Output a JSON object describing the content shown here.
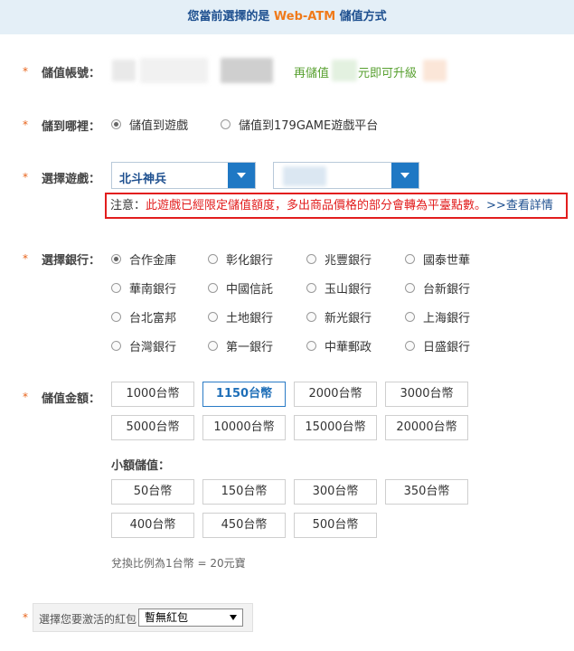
{
  "header": {
    "prefix": "您當前選擇的是 ",
    "method": "Web-ATM",
    "suffix": " 儲值方式"
  },
  "account": {
    "label": "儲值帳號：",
    "upgrade_prefix": "再儲值",
    "upgrade_suffix": "元即可升級"
  },
  "destination": {
    "label": "儲到哪裡：",
    "options": [
      {
        "label": "儲值到遊戲",
        "checked": true
      },
      {
        "label": "儲值到179GAME遊戲平台",
        "checked": false
      }
    ]
  },
  "game": {
    "label": "選擇遊戲：",
    "selected_game": "北斗神兵",
    "server_value": ""
  },
  "notice": {
    "prefix": "注意：",
    "message": "此遊戲已經限定儲值額度，多出商品價格的部分會轉為平臺點數。",
    "link": ">>查看詳情"
  },
  "bank": {
    "label": "選擇銀行：",
    "options": [
      {
        "label": "合作金庫",
        "checked": true
      },
      {
        "label": "彰化銀行",
        "checked": false
      },
      {
        "label": "兆豐銀行",
        "checked": false
      },
      {
        "label": "國泰世華",
        "checked": false
      },
      {
        "label": "華南銀行",
        "checked": false
      },
      {
        "label": "中國信託",
        "checked": false
      },
      {
        "label": "玉山銀行",
        "checked": false
      },
      {
        "label": "台新銀行",
        "checked": false
      },
      {
        "label": "台北富邦",
        "checked": false
      },
      {
        "label": "土地銀行",
        "checked": false
      },
      {
        "label": "新光銀行",
        "checked": false
      },
      {
        "label": "上海銀行",
        "checked": false
      },
      {
        "label": "台灣銀行",
        "checked": false
      },
      {
        "label": "第一銀行",
        "checked": false
      },
      {
        "label": "中華郵政",
        "checked": false
      },
      {
        "label": "日盛銀行",
        "checked": false
      }
    ]
  },
  "amount": {
    "label": "儲值金額：",
    "options": [
      "1000台幣",
      "1150台幣",
      "2000台幣",
      "3000台幣",
      "5000台幣",
      "10000台幣",
      "15000台幣",
      "20000台幣"
    ],
    "selected": "1150台幣",
    "small_label": "小額儲值：",
    "small_options": [
      "50台幣",
      "150台幣",
      "300台幣",
      "350台幣",
      "400台幣",
      "450台幣",
      "500台幣"
    ],
    "ratio_text": "兌換比例為1台幣 = 20元寶"
  },
  "red_packet": {
    "label": "選擇您要激活的紅包",
    "selected": "暫無紅包"
  },
  "colors": {
    "accent_orange": "#f07a1a",
    "header_blue": "#1d4f8f",
    "dropdown_blue": "#1f78c4",
    "notice_red": "#e21d1d",
    "upgrade_green": "#58a030"
  }
}
